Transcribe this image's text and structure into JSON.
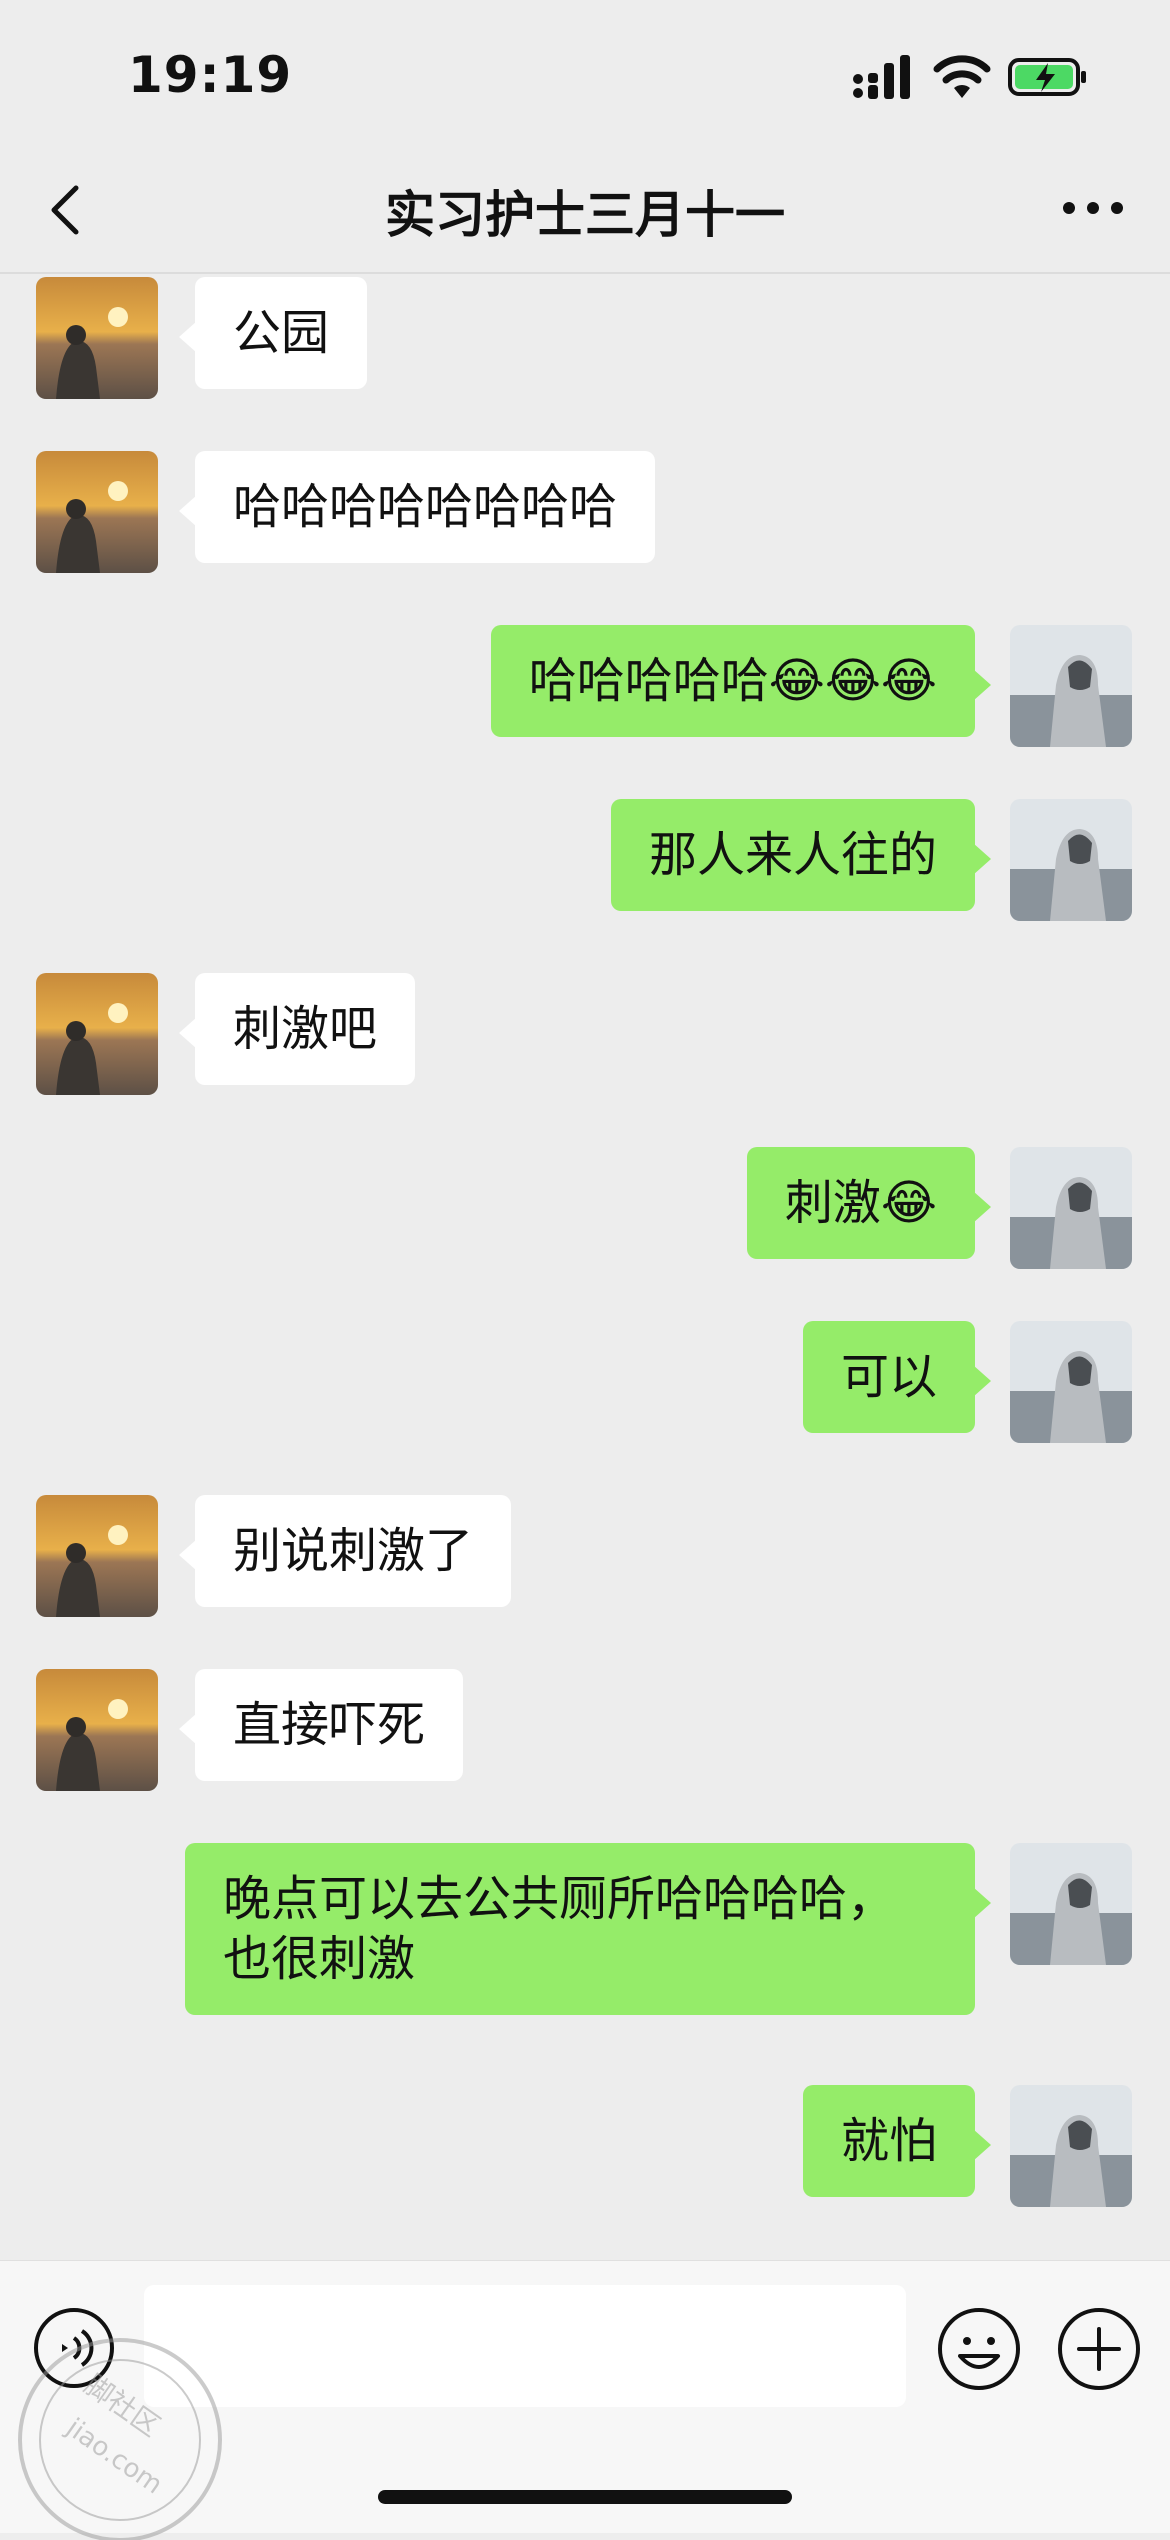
{
  "status_bar": {
    "time": "19:19"
  },
  "header": {
    "title": "实习护士三月十一"
  },
  "messages": [
    {
      "side": "left",
      "text": "公园"
    },
    {
      "side": "left",
      "text": "哈哈哈哈哈哈哈哈"
    },
    {
      "side": "right",
      "text": "哈哈哈哈哈😂😂😂"
    },
    {
      "side": "right",
      "text": "那人来人往的"
    },
    {
      "side": "left",
      "text": "刺激吧"
    },
    {
      "side": "right",
      "text": "刺激😂"
    },
    {
      "side": "right",
      "text": "可以"
    },
    {
      "side": "left",
      "text": "别说刺激了"
    },
    {
      "side": "left",
      "text": "直接吓死"
    },
    {
      "side": "right",
      "text": "晚点可以去公共厕所哈哈哈哈，也很刺激"
    },
    {
      "side": "right",
      "text": "就怕"
    }
  ],
  "input_bar": {
    "text_value": ""
  },
  "watermark": {
    "text_1": "脚社区",
    "text_2": "jiao.com"
  },
  "colors": {
    "background": "#ededed",
    "bubble_self": "#95ec69",
    "bubble_other": "#ffffff",
    "battery_fill": "#4cd964"
  },
  "icons": [
    "back-icon",
    "more-icon",
    "voice-icon",
    "emoji-icon",
    "plus-icon",
    "signal-icon",
    "wifi-icon",
    "battery-icon"
  ]
}
